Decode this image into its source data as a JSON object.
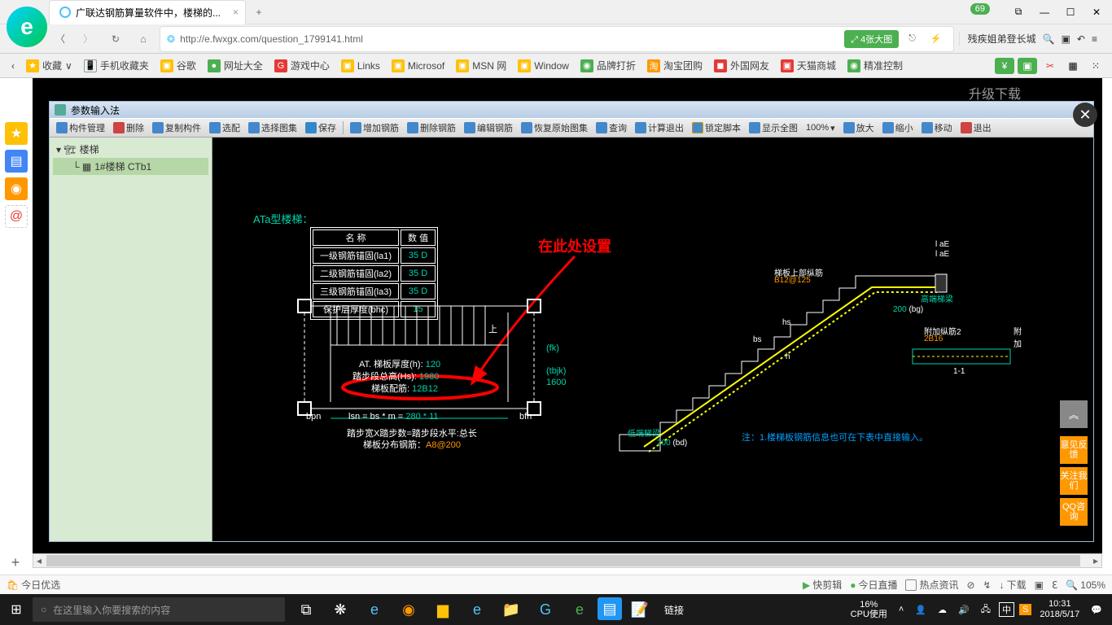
{
  "browser": {
    "tab_title": "广联达钢筋算量软件中，楼梯的...",
    "url": "http://e.fwxgx.com/question_1799141.html",
    "badge": "69",
    "enlarge_btn": "⤢ 4张大图",
    "right_title": "残疾姐弟登长城"
  },
  "bookmarks": {
    "fav": "收藏",
    "items": [
      "手机收藏夹",
      "谷歌",
      "网址大全",
      "游戏中心",
      "Links",
      "Microsof",
      "MSN 网",
      "Window",
      "品牌打折",
      "淘宝团购",
      "外国网友",
      "天猫商城",
      "精准控制"
    ]
  },
  "upgrade": "升级下载",
  "app": {
    "title": "参数输入法",
    "toolbar": {
      "component_mgr": "构件管理",
      "delete": "删除",
      "copy_comp": "复制构件",
      "select": "选配",
      "select_atlas": "选择图集",
      "save": "保存",
      "add_rebar": "增加钢筋",
      "del_rebar": "删除钢筋",
      "edit_rebar": "编辑钢筋",
      "restore_atlas": "恢复原始图集",
      "query": "查询",
      "calc_exit": "计算退出",
      "lock_script": "锁定脚本",
      "show_all": "显示全图",
      "zoom_pct": "100%",
      "zoom_in": "放大",
      "zoom_out": "缩小",
      "move": "移动",
      "exit": "退出"
    },
    "tree": {
      "root": "楼梯",
      "child": "1#楼梯 CTb1"
    }
  },
  "drawing": {
    "heading": "ATa型楼梯：",
    "table": {
      "h1": "名  称",
      "h2": "数  值",
      "r1_name": "一级钢筋锚固(la1)",
      "r1_val": "35 D",
      "r2_name": "二级钢筋锚固(la2)",
      "r2_val": "35 D",
      "r3_name": "三级钢筋锚固(la3)",
      "r3_val": "35 D",
      "r4_name": "保护层厚度(bhc)",
      "r4_val": "15"
    },
    "annotation": "在此处设置",
    "params": {
      "thickness_label": "AT. 梯板厚度(h):",
      "thickness_val": "120",
      "step_height_label": "踏步段总高(Hs):",
      "step_height_val": "1980",
      "tibanpeijin_label": "梯板配筋:",
      "tibanpeijin_val": "12B12",
      "fk": "(fk)",
      "tbjk": "(tbjk)",
      "h1600": "1600",
      "lsn_formula": "lsn = bs * m =",
      "lsn_val": "280 * 11",
      "bpn": "bpn",
      "bfn": "bfn",
      "step_note": "踏步宽X踏步数=踏步段水平:总长",
      "dist_rebar_label": "梯板分布钢筋：",
      "dist_rebar_val": "A8@200",
      "up": "上"
    },
    "right_section": {
      "top_rebar_label": "梯板上部纵筋",
      "top_rebar_val": "B12@125",
      "high_beam": "高端梯梁",
      "low_beam": "低端梯梁",
      "extra_rebar_label": "附加纵筋2",
      "extra_rebar_val": "2B16",
      "extra_rebar_r": "附加",
      "bg": "(bg)",
      "bd": "(bd)",
      "v200a": "200",
      "v200b": "200",
      "sec11": "1-1",
      "laE1": "l aE",
      "laE2": "l aE",
      "hs": "hs",
      "bs": "bs",
      "h": "h"
    },
    "note": "注：1.楼梯板钢筋信息也可在下表中直接输入。"
  },
  "right_float": {
    "top": "︽",
    "feedback": "意见反馈",
    "follow": "关注我们",
    "qq": "QQ咨询"
  },
  "status": {
    "today": "今日优选",
    "quick_cut": "快剪辑",
    "today_live": "今日直播",
    "hot_news": "热点资讯",
    "download": "下载",
    "zoom": "105%"
  },
  "taskbar": {
    "search_placeholder": "在这里输入你要搜索的内容",
    "link": "链接",
    "cpu_pct": "16%",
    "cpu_label": "CPU使用",
    "ime": "中",
    "time": "10:31",
    "date": "2018/5/17"
  }
}
